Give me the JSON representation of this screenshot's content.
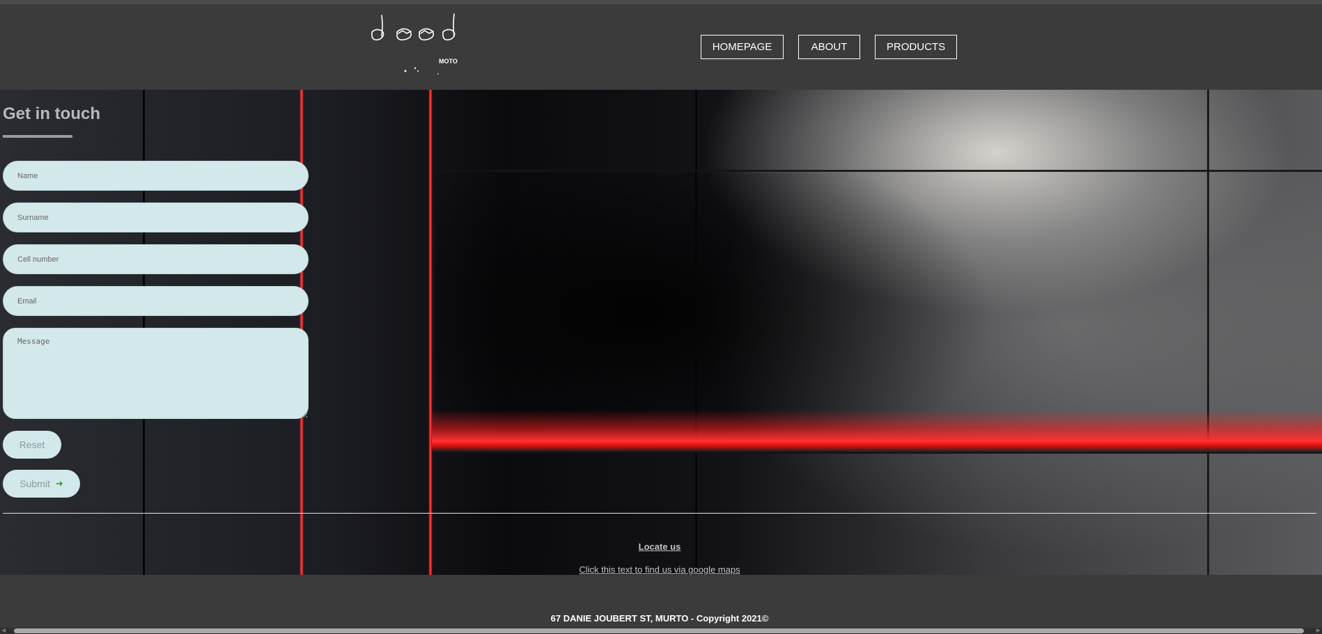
{
  "nav": {
    "items": [
      {
        "label": "HOMEPAGE"
      },
      {
        "label": "ABOUT"
      },
      {
        "label": "PRODUCTS"
      }
    ]
  },
  "logo": {
    "text": "dood",
    "subtext": "MOTO"
  },
  "form": {
    "title": "Get in touch",
    "fields": {
      "name_placeholder": "Name",
      "surname_placeholder": "Surname",
      "cell_placeholder": "Cell number",
      "email_placeholder": "Email",
      "message_placeholder": "Message"
    },
    "reset_label": "Reset",
    "submit_label": "Submit",
    "submit_icon": "arrow-right-icon"
  },
  "locate": {
    "title": "Locate us",
    "link_text": "Click this text to find us via google maps"
  },
  "footer": {
    "copyright": "67 DANIE JOUBERT ST, MURTO - Copyright 2021©"
  },
  "colors": {
    "page_bg": "#3b3b3b",
    "field_bg": "#d3e8ea",
    "accent_red": "#ff2a2a",
    "arrow_green": "#3aa020"
  }
}
